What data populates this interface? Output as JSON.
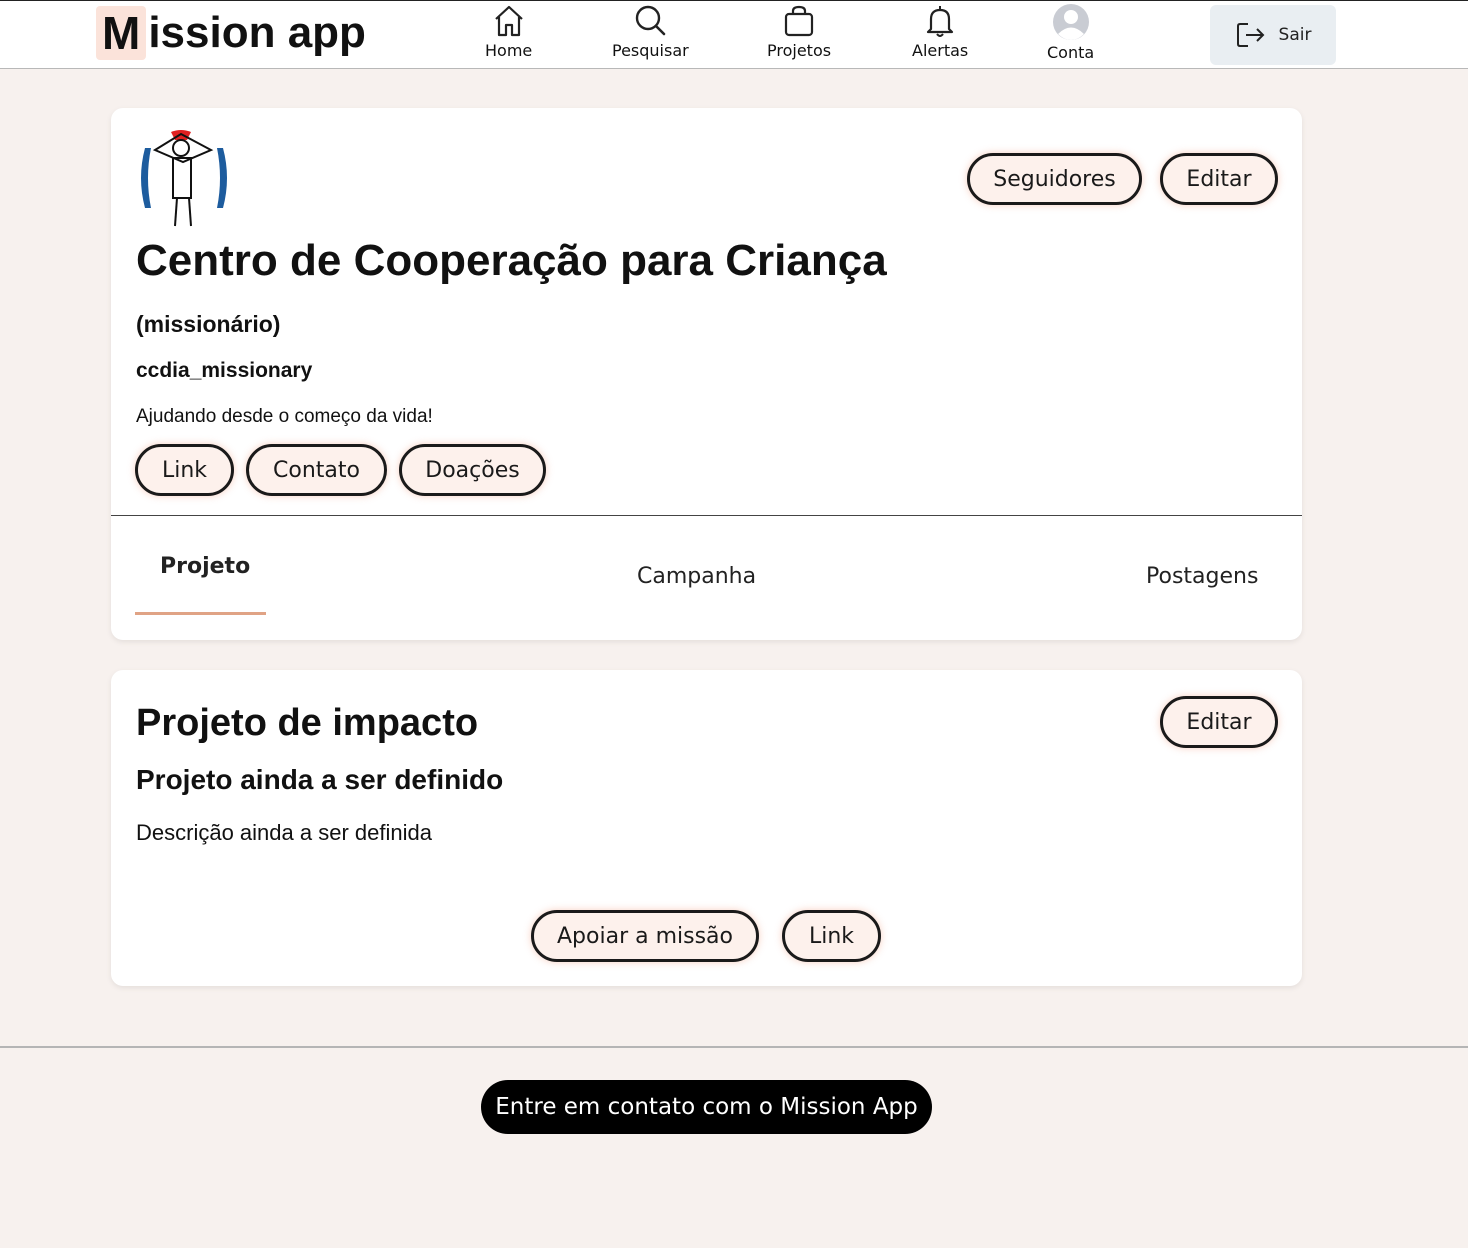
{
  "header": {
    "logo_initial": "M",
    "logo_rest": "ission app",
    "nav": [
      {
        "label": "Home",
        "icon": "home-icon"
      },
      {
        "label": "Pesquisar",
        "icon": "search-icon"
      },
      {
        "label": "Projetos",
        "icon": "bag-icon"
      },
      {
        "label": "Alertas",
        "icon": "bell-icon"
      },
      {
        "label": "Conta",
        "icon": "user-avatar-icon"
      }
    ],
    "logout_label": "Sair"
  },
  "profile": {
    "name": "Centro de Cooperação para Criança",
    "role": "(missionário)",
    "handle": "ccdia_missionary",
    "bio": "Ajudando desde o começo da vida!",
    "followers_label": "Seguidores",
    "edit_label": "Editar",
    "links": [
      "Link",
      "Contato",
      "Doações"
    ],
    "tabs": [
      "Projeto",
      "Campanha",
      "Postagens"
    ],
    "active_tab": "Projeto"
  },
  "project": {
    "title": "Projeto de impacto",
    "subtitle": "Projeto ainda a ser definido",
    "description": "Descrição ainda a ser definida",
    "edit_label": "Editar",
    "support_label": "Apoiar a missão",
    "link_label": "Link"
  },
  "footer": {
    "contact_label": "Entre em contato com o Mission App"
  },
  "colors": {
    "page_bg": "#f7f1ee",
    "pill_bg": "#fdf1ec",
    "accent": "#e0a385",
    "logo_highlight": "#fbe3da"
  }
}
